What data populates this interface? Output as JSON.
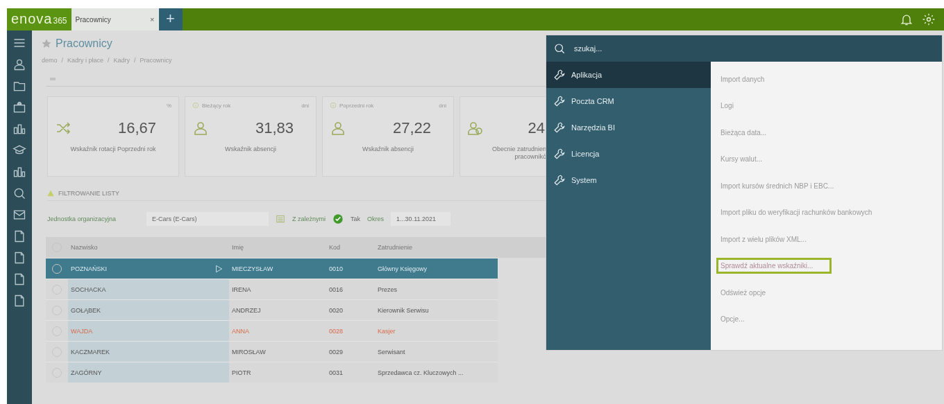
{
  "topbar": {
    "logo": "enova",
    "logo_suffix": "365",
    "tabs": [
      {
        "label": "Pracownicy",
        "close": "×",
        "selected": true
      }
    ],
    "add_tab": "+"
  },
  "page": {
    "title": "Pracownicy",
    "favorite": true,
    "breadcrumb": [
      {
        "label": "demo"
      },
      {
        "separator": "/",
        "label": "Kadry i płace"
      },
      {
        "separator": "/",
        "label": "Kadry"
      },
      {
        "separator": "/",
        "label": "Pracownicy"
      }
    ]
  },
  "kpis": [
    {
      "kind": "rotation",
      "unit": "%",
      "value": "16,67",
      "label": "Wskaźnik rotacji Poprzedni rok"
    },
    {
      "kind": "absence",
      "period": "Bieżący rok",
      "unit": "dni",
      "value": "31,83",
      "label": "Wskaźnik absencji"
    },
    {
      "kind": "absence",
      "period": "Poprzedni rok",
      "unit": "dni",
      "value": "27,22",
      "label": "Wskaźnik absencji"
    },
    {
      "kind": "employees",
      "value": "24",
      "label": "Obecnie zatrudnien",
      "label_2": "pracownikó"
    }
  ],
  "filter": {
    "title": "FILTROWANIE LISTY",
    "unit_label": "Jednostka organizacyjna",
    "unit_value": "E-Cars (E-Cars)",
    "sub_label": "Z zależnymi",
    "sub_checked": true,
    "sub_value": "Tak",
    "period_label": "Okres",
    "period_value": "1...30.11.2021"
  },
  "table": {
    "all_checked": false,
    "columns": [
      "Nazwisko",
      "Imię",
      "Kod",
      "Zatrudnienie"
    ],
    "rows": [
      {
        "cells": [
          "POZNAŃSKI",
          "MIECZYSŁAW",
          "0010",
          "Główny Księgowy"
        ],
        "selected": true,
        "checked": false,
        "flagged": false
      },
      {
        "cells": [
          "SOCHACKA",
          "IRENA",
          "0016",
          "Prezes"
        ],
        "selected": false,
        "checked": false,
        "flagged": false
      },
      {
        "cells": [
          "GOŁĄBEK",
          "ANDRZEJ",
          "0020",
          "Kierownik Serwisu"
        ],
        "selected": false,
        "checked": false,
        "flagged": false
      },
      {
        "cells": [
          "WAJDA",
          "ANNA",
          "0028",
          "Kasjer"
        ],
        "selected": false,
        "checked": false,
        "flagged": true
      },
      {
        "cells": [
          "KACZMAREK",
          "MIROSŁAW",
          "0029",
          "Serwisant"
        ],
        "selected": false,
        "checked": false,
        "flagged": false
      },
      {
        "cells": [
          "ZAGÓRNY",
          "PIOTR",
          "0031",
          "Sprzedawca cz. Kluczowych ..."
        ],
        "selected": false,
        "checked": false,
        "flagged": false
      }
    ]
  },
  "menu": {
    "search_placeholder": "szukaj...",
    "categories": [
      {
        "label": "Aplikacja",
        "selected": true
      },
      {
        "label": "Poczta CRM",
        "selected": false
      },
      {
        "label": "Narzędzia BI",
        "selected": false
      },
      {
        "label": "Licencja",
        "selected": false
      },
      {
        "label": "System",
        "selected": false
      }
    ],
    "items": [
      {
        "label": "Import danych",
        "highlighted": false
      },
      {
        "label": "Logi",
        "highlighted": false
      },
      {
        "label": "Bieżąca data...",
        "highlighted": false
      },
      {
        "label": "Kursy walut...",
        "highlighted": false
      },
      {
        "label": "Import kursów średnich NBP i EBC...",
        "highlighted": false
      },
      {
        "label": "Import pliku do weryfikacji rachunków bankowych",
        "highlighted": false
      },
      {
        "label": "Import z wielu plików XML...",
        "highlighted": false
      },
      {
        "label": "Sprawdź aktualne wskaźniki...",
        "highlighted": true
      },
      {
        "label": "Odśwież opcje",
        "highlighted": false
      },
      {
        "label": "Opcje...",
        "highlighted": false
      }
    ]
  }
}
